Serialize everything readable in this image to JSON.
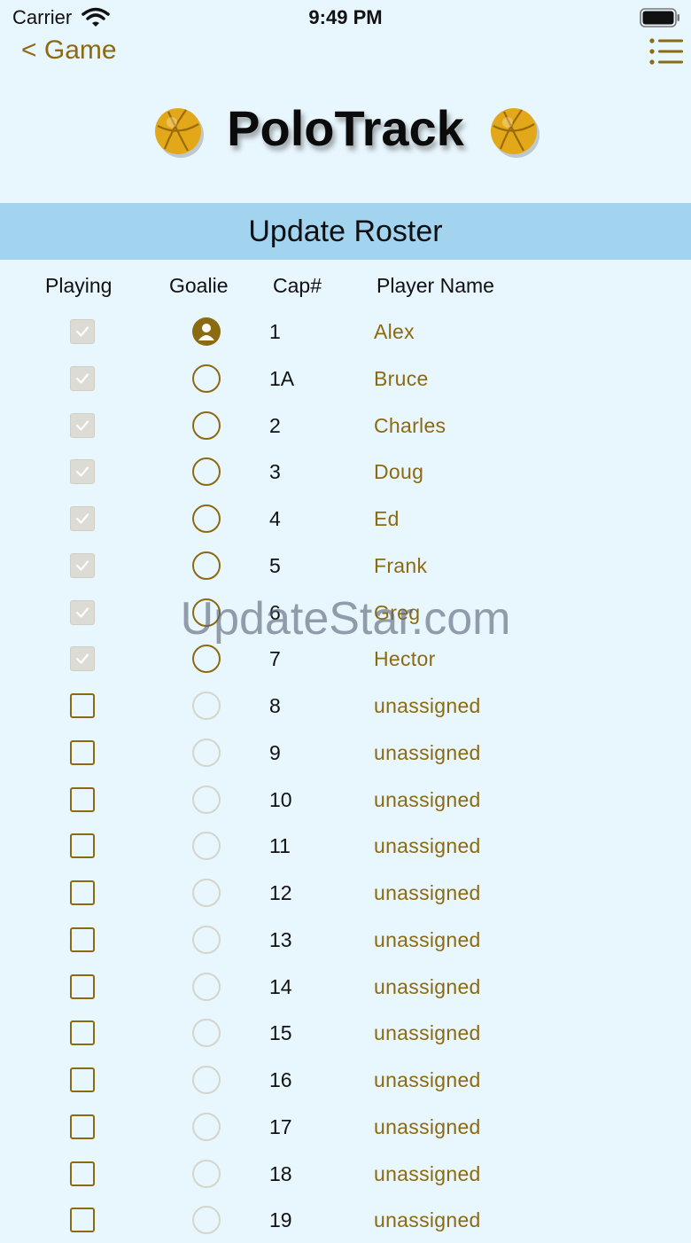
{
  "status_bar": {
    "carrier": "Carrier",
    "time": "9:49 PM"
  },
  "nav": {
    "back_label": "< Game",
    "menu_icon": "list-icon"
  },
  "app": {
    "title": "PoloTrack",
    "logo_icon": "water-polo-ball-icon"
  },
  "section": {
    "title": "Update Roster"
  },
  "columns": {
    "playing": "Playing",
    "goalie": "Goalie",
    "cap": "Cap#",
    "name": "Player Name"
  },
  "roster": [
    {
      "cap": "1",
      "name": "Alex",
      "playing": true,
      "goalie": true
    },
    {
      "cap": "1A",
      "name": "Bruce",
      "playing": true,
      "goalie": false
    },
    {
      "cap": "2",
      "name": "Charles",
      "playing": true,
      "goalie": false
    },
    {
      "cap": "3",
      "name": "Doug",
      "playing": true,
      "goalie": false
    },
    {
      "cap": "4",
      "name": "Ed",
      "playing": true,
      "goalie": false
    },
    {
      "cap": "5",
      "name": "Frank",
      "playing": true,
      "goalie": false
    },
    {
      "cap": "6",
      "name": "Greg",
      "playing": true,
      "goalie": false
    },
    {
      "cap": "7",
      "name": "Hector",
      "playing": true,
      "goalie": false
    },
    {
      "cap": "8",
      "name": "unassigned",
      "playing": false,
      "goalie": false
    },
    {
      "cap": "9",
      "name": "unassigned",
      "playing": false,
      "goalie": false
    },
    {
      "cap": "10",
      "name": "unassigned",
      "playing": false,
      "goalie": false
    },
    {
      "cap": "11",
      "name": "unassigned",
      "playing": false,
      "goalie": false
    },
    {
      "cap": "12",
      "name": "unassigned",
      "playing": false,
      "goalie": false
    },
    {
      "cap": "13",
      "name": "unassigned",
      "playing": false,
      "goalie": false
    },
    {
      "cap": "14",
      "name": "unassigned",
      "playing": false,
      "goalie": false
    },
    {
      "cap": "15",
      "name": "unassigned",
      "playing": false,
      "goalie": false
    },
    {
      "cap": "16",
      "name": "unassigned",
      "playing": false,
      "goalie": false
    },
    {
      "cap": "17",
      "name": "unassigned",
      "playing": false,
      "goalie": false
    },
    {
      "cap": "18",
      "name": "unassigned",
      "playing": false,
      "goalie": false
    },
    {
      "cap": "19",
      "name": "unassigned",
      "playing": false,
      "goalie": false
    }
  ],
  "watermark": "UpdateStar.com",
  "colors": {
    "accent": "#8b6a12",
    "background": "#e8f6fd",
    "header_band": "#a2d3ef"
  }
}
